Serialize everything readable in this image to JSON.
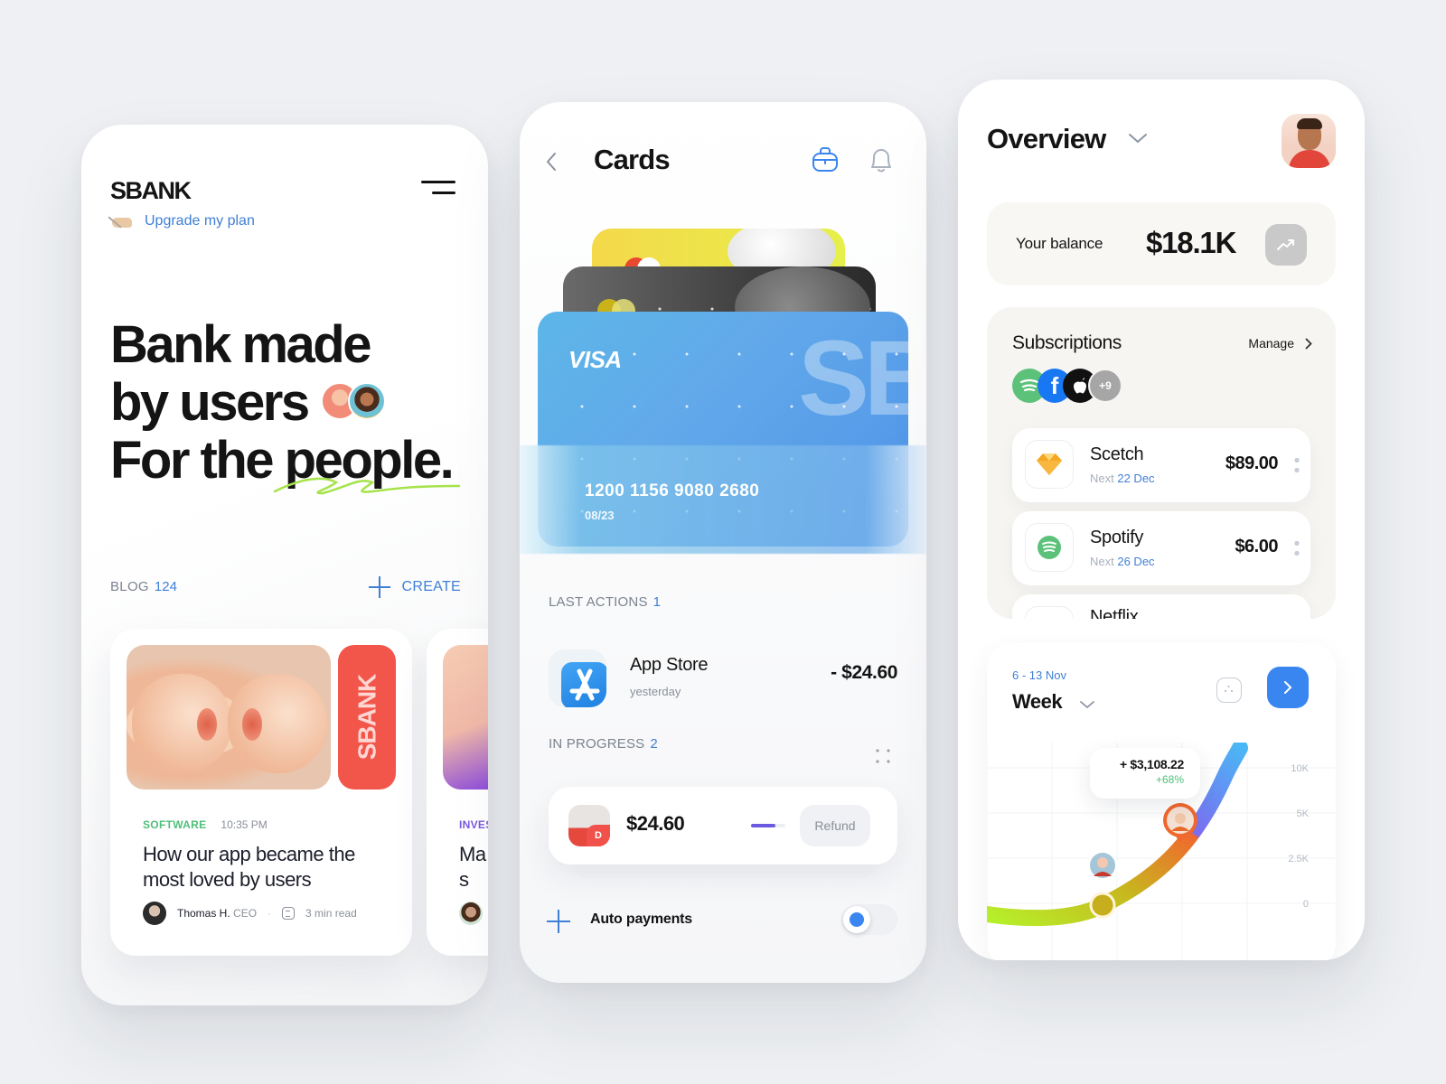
{
  "left_screen": {
    "logo": "SBANK",
    "upgrade_label": "Upgrade my plan",
    "hero_lines": [
      "Bank made",
      "by users",
      "For the people."
    ],
    "blog": {
      "label": "BLOG",
      "count": "124",
      "create_label": "CREATE"
    },
    "posts": [
      {
        "badge": "SBANK",
        "category": "SOFTWARE",
        "category_color": "#4fbf7a",
        "time": "10:35 PM",
        "title": "How our app became the most loved by users",
        "author": "Thomas H.",
        "role": "CEO",
        "separator": "·",
        "read_time": "3 min read"
      },
      {
        "category": "INVES",
        "category_color": "#7b5bdb",
        "title": "Ma firs"
      }
    ]
  },
  "middle_screen": {
    "title": "Cards",
    "cards": [
      {
        "network": "VISA",
        "watermark": "SB",
        "number": "1200 1156 9080 2680",
        "expiry": "08/23"
      }
    ],
    "last_actions": {
      "label": "LAST ACTIONS",
      "count": "1",
      "items": [
        {
          "name": "App Store",
          "subtitle": "yesterday",
          "amount": "- $24.60"
        }
      ]
    },
    "in_progress": {
      "label": "IN PROGRESS",
      "count": "2",
      "item": {
        "amount": "$24.60",
        "avatar_badge": "D",
        "progress": 0.7,
        "action_label": "Refund"
      }
    },
    "auto_payments": {
      "label": "Auto payments",
      "enabled": true
    }
  },
  "right_screen": {
    "title": "Overview",
    "balance": {
      "label": "Your balance",
      "value": "$18.1K"
    },
    "subscriptions": {
      "title": "Subscriptions",
      "manage_label": "Manage",
      "extra_count": "+9",
      "items": [
        {
          "name": "Scetch",
          "next_label": "Next",
          "next_date": "22 Dec",
          "price": "$89.00"
        },
        {
          "name": "Spotify",
          "next_label": "Next",
          "next_date": "26 Dec",
          "price": "$6.00"
        },
        {
          "name": "Netflix"
        }
      ]
    },
    "week": {
      "range": "6 - 13 Nov",
      "title": "Week",
      "tooltip_value": "+ $3,108.22",
      "tooltip_change": "+68%"
    },
    "chart_data": {
      "type": "line",
      "title": "Week",
      "y_ticks": [
        "10K",
        "5K",
        "2.5K",
        "0"
      ],
      "annotation": {
        "value": "+ $3,108.22",
        "change": "+68%"
      }
    }
  },
  "colors": {
    "accent_blue": "#3a86f0",
    "link_blue": "#3f7fd6",
    "positive_green": "#4fbf7a",
    "badge_red": "#f2564b"
  }
}
